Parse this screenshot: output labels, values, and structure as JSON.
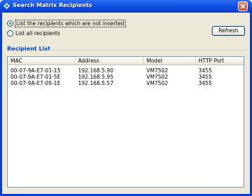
{
  "window": {
    "title": "Search Matrix Recipients",
    "icon": "diamond-app-icon",
    "close_icon": "close-x-icon"
  },
  "options": {
    "not_inserted_label": "List the recipients which are not inserted",
    "all_label": "List all recipients",
    "selected": "not_inserted"
  },
  "refresh_label": "Refresh",
  "recipient_list": {
    "title": "Recipient List",
    "columns": [
      "MAC",
      "Address",
      "Model",
      "HTTP Port"
    ],
    "rows": [
      [
        "00-07-9A-E7-01-15",
        "192.168.5.90",
        "VM7502",
        "3455"
      ],
      [
        "00-07-9A-E7-01-5E",
        "192.168.5.95",
        "VM7502",
        "3455"
      ],
      [
        "00-07-9A-E7-05-1E",
        "192.168.5.57",
        "VM7502",
        "3455"
      ]
    ]
  },
  "colors": {
    "titlebar": "#0b47d6",
    "client_bg": "#ece9d8",
    "group_title": "#0046d5",
    "close_button": "#d1401d"
  }
}
